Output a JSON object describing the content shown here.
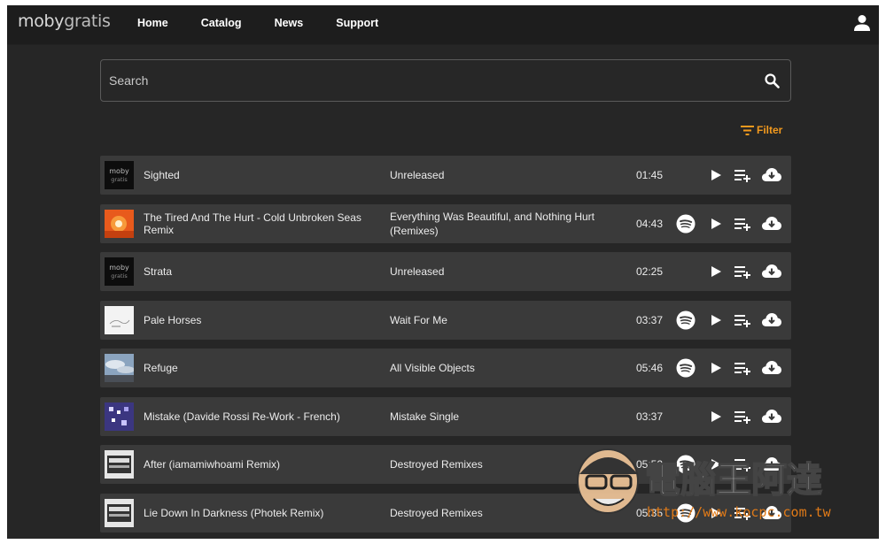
{
  "header": {
    "logo": {
      "a": "moby",
      "b": "gratis"
    },
    "nav": [
      "Home",
      "Catalog",
      "News",
      "Support"
    ]
  },
  "search": {
    "placeholder": "Search",
    "value": ""
  },
  "filter": {
    "label": "Filter"
  },
  "colors": {
    "accent": "#f39a1e",
    "row": "#3a3a3a",
    "bg": "#262626",
    "topbar": "#1d1d1d"
  },
  "tracks": [
    {
      "title": "Sighted",
      "album": "Unreleased",
      "duration": "01:45",
      "spotify": false,
      "art": "moby-gratis"
    },
    {
      "title": "The Tired And The Hurt - Cold Unbroken Seas Remix",
      "album": "Everything Was Beautiful, and Nothing Hurt (Remixes)",
      "duration": "04:43",
      "spotify": true,
      "art": "orange-sun"
    },
    {
      "title": "Strata",
      "album": "Unreleased",
      "duration": "02:25",
      "spotify": false,
      "art": "moby-gratis"
    },
    {
      "title": "Pale Horses",
      "album": "Wait For Me",
      "duration": "03:37",
      "spotify": true,
      "art": "white-sketch"
    },
    {
      "title": "Refuge",
      "album": "All Visible Objects",
      "duration": "05:46",
      "spotify": true,
      "art": "sky-clouds"
    },
    {
      "title": "Mistake (Davide Rossi Re-Work - French)",
      "album": "Mistake Single",
      "duration": "03:37",
      "spotify": false,
      "art": "purple-grid"
    },
    {
      "title": "After (iamamiwhoami Remix)",
      "album": "Destroyed Remixes",
      "duration": "05:52",
      "spotify": true,
      "art": "destroyed-remixes"
    },
    {
      "title": "Lie Down In Darkness (Photek Remix)",
      "album": "Destroyed Remixes",
      "duration": "05:35",
      "spotify": true,
      "art": "destroyed-remixes"
    }
  ],
  "watermark": {
    "text": "電腦王阿達",
    "url": "http://www.kocpc.com.tw"
  }
}
